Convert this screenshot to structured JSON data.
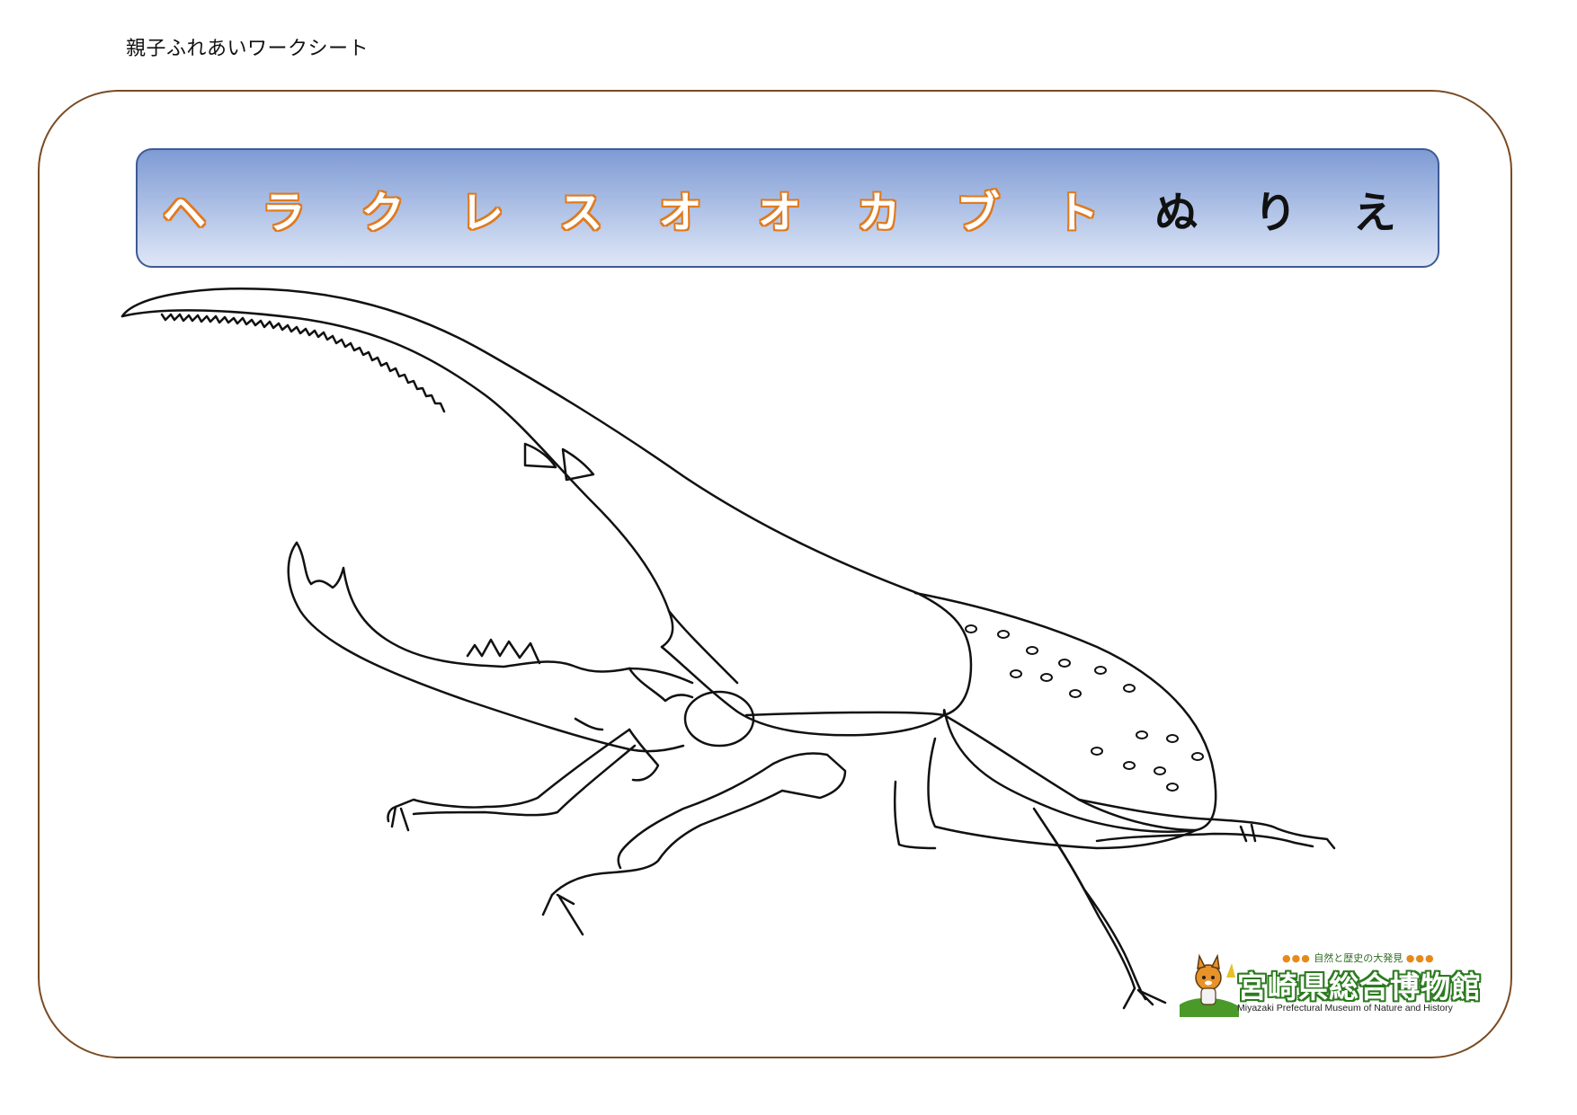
{
  "header": {
    "sheet_label": "親子ふれあいワークシート"
  },
  "title": {
    "katakana": [
      "ヘ",
      "ラ",
      "ク",
      "レ",
      "ス",
      "オ",
      "オ",
      "カ",
      "ブ",
      "ト"
    ],
    "hiragana": [
      "ぬ",
      "り",
      "え"
    ],
    "katakana_color": "#ffffff",
    "katakana_outline_color": "#e07a1e",
    "hiragana_color": "#111111",
    "banner_gradient": [
      "#7f9bd4",
      "#dfe7f7"
    ],
    "banner_border_color": "#3d5a96"
  },
  "frame": {
    "border_color": "#7a4a22"
  },
  "illustration": {
    "subject_icon": "hercules-beetle-line-art",
    "line_color": "#111111"
  },
  "museum": {
    "tagline": "自然と歴史の大発見",
    "name": "宮崎県総合博物館",
    "english_name": "Miyazaki Prefectural Museum of Nature and History",
    "mascot_icon": "museum-mascot-icon",
    "brand_color": "#2b7a1f",
    "accent_color": "#e58a1a"
  }
}
